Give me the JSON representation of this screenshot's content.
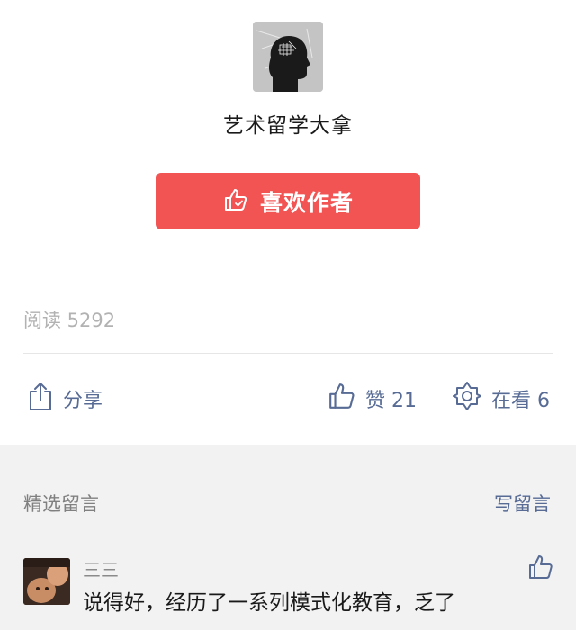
{
  "author": {
    "name": "艺术留学大拿"
  },
  "like_author_button": {
    "label": "喜欢作者",
    "color": "#f25353"
  },
  "stats": {
    "read": "阅读 5292"
  },
  "actions": {
    "share": "分享",
    "like": "赞 21",
    "wow": "在看 6",
    "link_color": "#576b95"
  },
  "comments": {
    "section_title": "精选留言",
    "write": "写留言",
    "items": [
      {
        "author": "三三",
        "text": "说得好，经历了一系列模式化教育，乏了"
      }
    ]
  },
  "icons": {
    "thumb": "thumbs-up-icon",
    "share": "share-icon",
    "wow": "wow-star-icon"
  }
}
